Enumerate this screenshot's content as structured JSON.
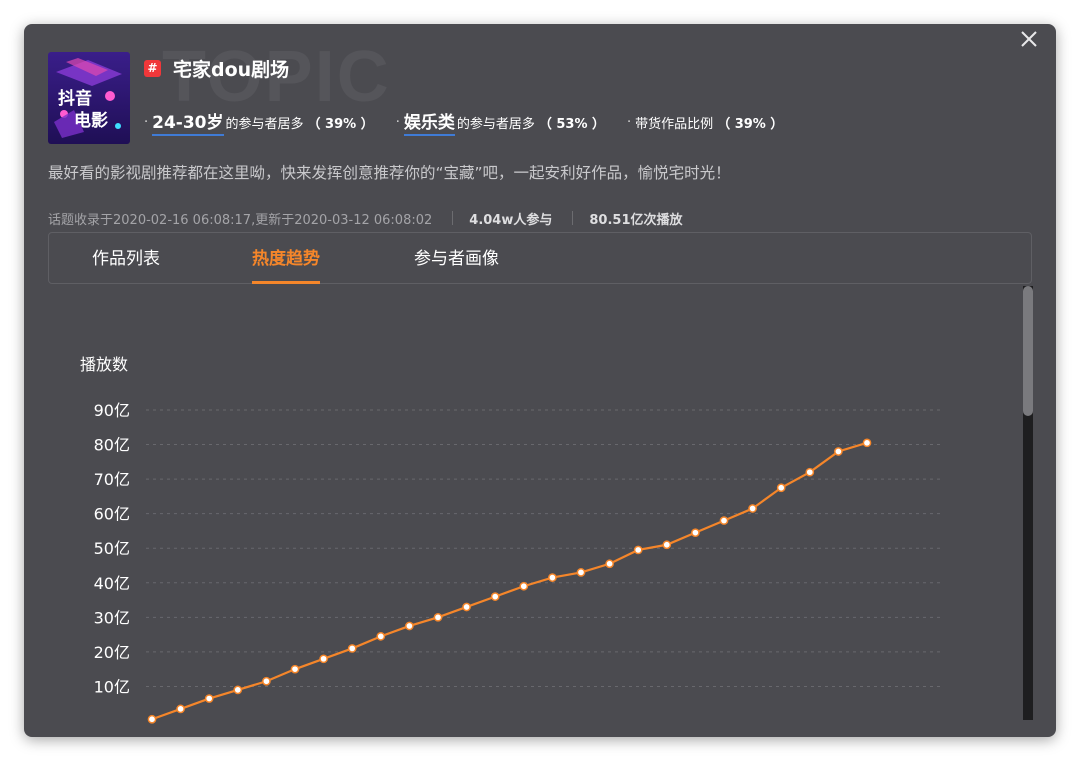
{
  "watermark": "TOPIC",
  "topic": {
    "hash": "#",
    "title": "宅家dou剧场",
    "thumbnail_lines": [
      "抖音",
      "电影"
    ]
  },
  "stats": [
    {
      "highlight": "24-30岁",
      "text": "的参与者居多",
      "value": "（ 39% ）"
    },
    {
      "highlight": "娱乐类",
      "text": "的参与者居多",
      "value": "（ 53% ）"
    },
    {
      "highlight": "",
      "text": "带货作品比例",
      "value": "（ 39% ）"
    }
  ],
  "description": "最好看的影视剧推荐都在这里呦，快来发挥创意推荐你的“宝藏”吧，一起安利好作品，愉悦宅时光！",
  "meta": {
    "dates": "话题收录于2020-02-16 06:08:17,更新于2020-03-12 06:08:02",
    "participants": "4.04w人参与",
    "plays": "80.51亿次播放"
  },
  "tabs": [
    {
      "label": "作品列表",
      "active": false
    },
    {
      "label": "热度趋势",
      "active": true
    },
    {
      "label": "参与者画像",
      "active": false
    }
  ],
  "colors": {
    "accent": "#f5862a",
    "panel_bg": "#4b4b50",
    "highlight_underline": "#3f7bd6",
    "hash_badge": "#f0373a"
  },
  "icons": {
    "close": "close-icon",
    "hash": "hash-badge-icon",
    "thumbnail": "douyin-movie-logo"
  },
  "scrollbar": {
    "position": 0.0
  },
  "chart_data": {
    "type": "line",
    "ylabel": "播放数",
    "yticks": [
      "90亿",
      "80亿",
      "70亿",
      "60亿",
      "50亿",
      "40亿",
      "30亿",
      "20亿",
      "10亿"
    ],
    "ytick_values": [
      90,
      80,
      70,
      60,
      50,
      40,
      30,
      20,
      10
    ],
    "ylim": [
      0,
      90
    ],
    "grid": true,
    "series": [
      {
        "values": [
          0.5,
          3.5,
          6.5,
          9,
          11.5,
          15,
          18,
          21,
          24.5,
          27.5,
          30,
          33,
          36,
          39,
          41.5,
          43,
          45.5,
          49.5,
          51,
          54.5,
          58,
          61.5,
          67.5,
          72,
          78,
          80.5
        ]
      }
    ]
  }
}
